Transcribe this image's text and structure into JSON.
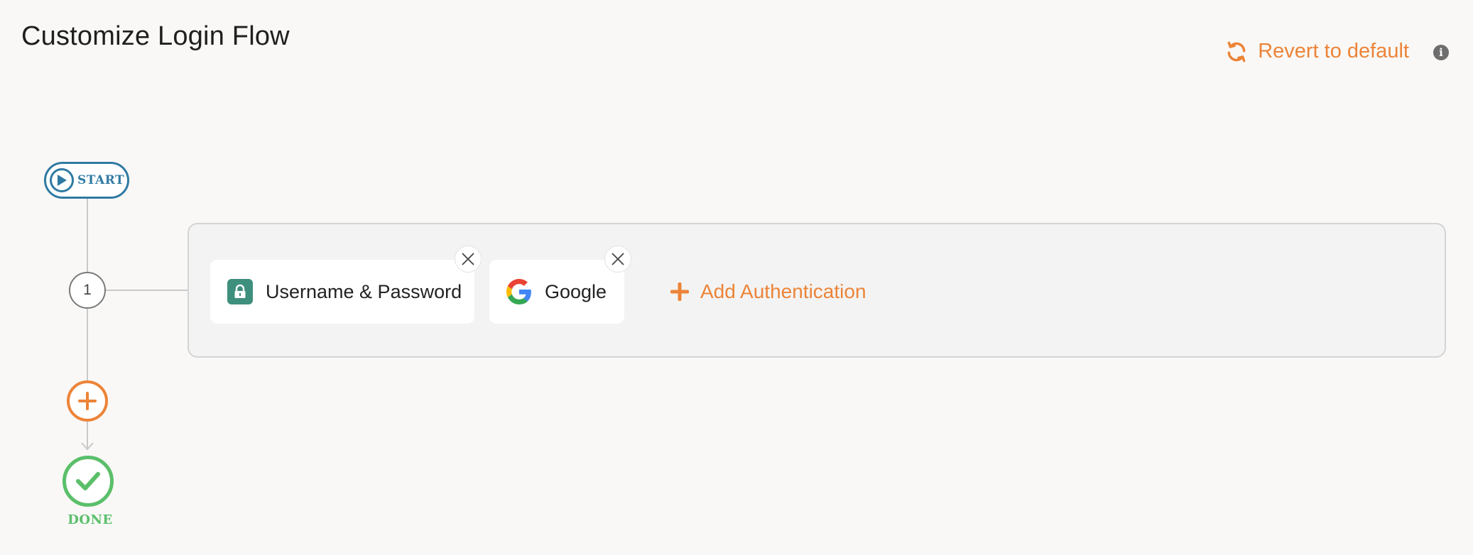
{
  "header": {
    "title": "Customize Login Flow",
    "revert_label": "Revert to default",
    "info_glyph": "i"
  },
  "flow": {
    "start_label": "START",
    "steps": [
      {
        "number": "1",
        "methods": [
          {
            "label": "Username & Password",
            "icon": "lock-icon"
          },
          {
            "label": "Google",
            "icon": "google-icon"
          }
        ],
        "add_label": "Add Authentication"
      }
    ],
    "done_label": "DONE"
  },
  "colors": {
    "accent": "#ec8438",
    "start": "#2f7aa3",
    "done": "#5bbf6a",
    "lock_badge": "#3f8f7d"
  }
}
